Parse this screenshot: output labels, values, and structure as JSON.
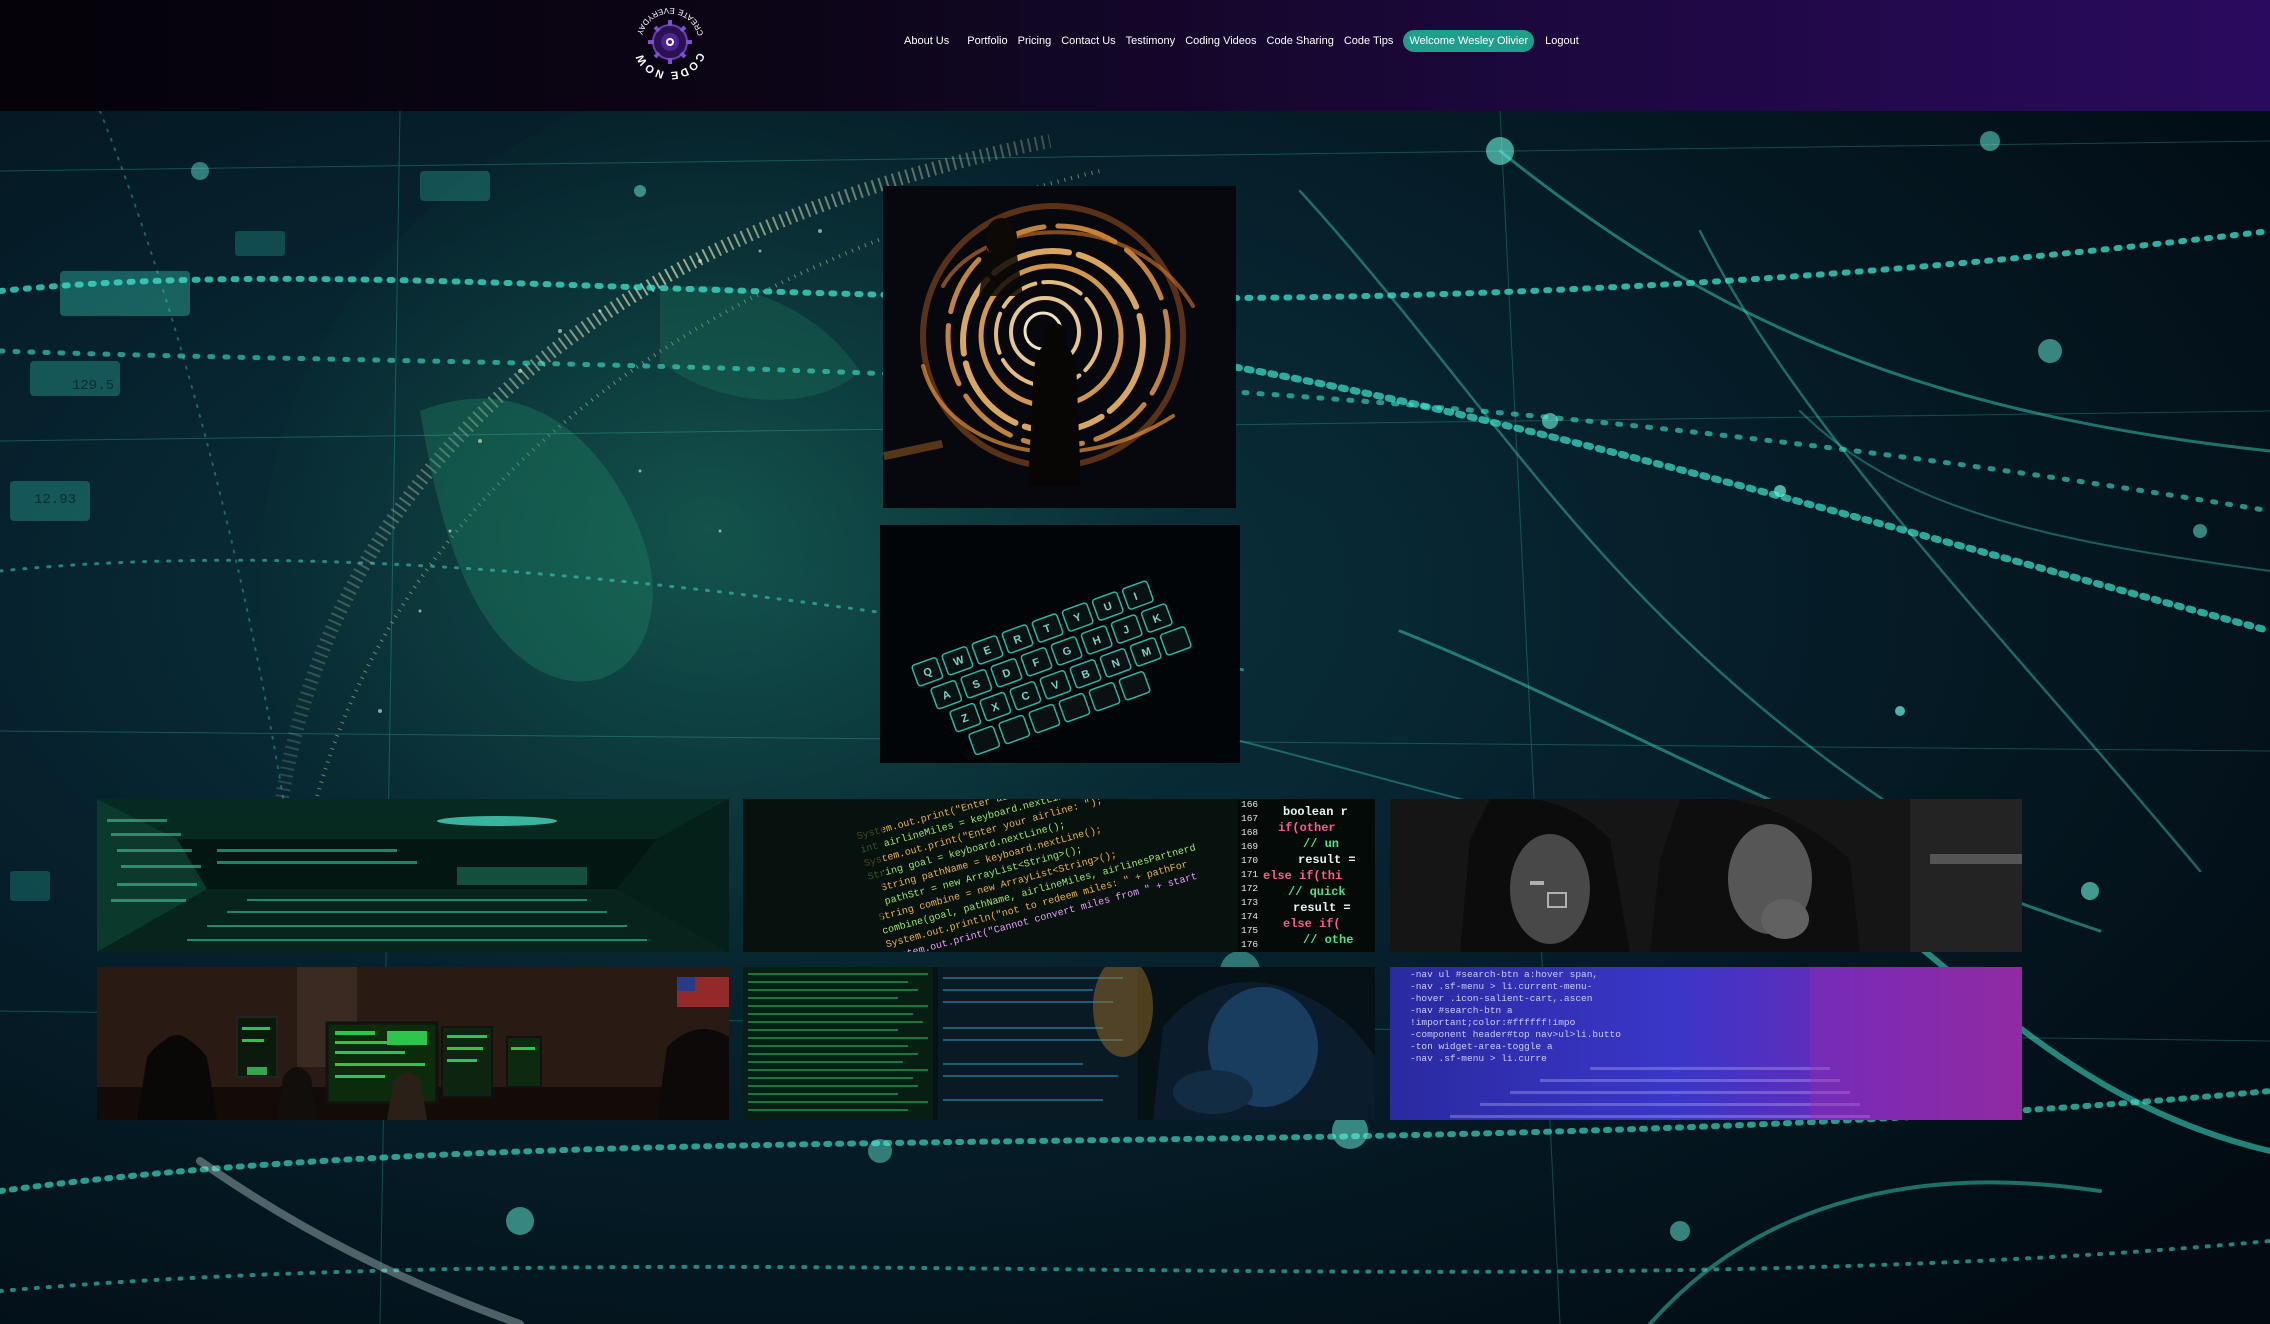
{
  "logo": {
    "top_text": "CODE NOW",
    "bottom_text": "CREATE EVERYDAY",
    "icon": "gear-brain-logo"
  },
  "nav": {
    "items": [
      {
        "label": "About Us"
      },
      {
        "label": "Portfolio"
      },
      {
        "label": "Pricing"
      },
      {
        "label": "Contact Us"
      },
      {
        "label": "Testimony"
      },
      {
        "label": "Coding Videos"
      },
      {
        "label": "Code Sharing"
      },
      {
        "label": "Code Tips"
      },
      {
        "label": "Welcome Wesley Olivier"
      },
      {
        "label": "Logout"
      }
    ]
  },
  "code_snippets": {
    "line_numbers": [
      "166",
      "167",
      "168",
      "169",
      "170",
      "171",
      "172",
      "173",
      "174",
      "175",
      "176"
    ],
    "right_column": [
      "boolean r",
      "if(other",
      "// un",
      "result =",
      "else if(thi",
      "// quick",
      "result =",
      "else if(",
      "// othe"
    ],
    "center": [
      "System.out.print(\"Enter airline miles are on: \");",
      "int airlineMiles = keyboard.nextLine();",
      "System.out.print(\"Enter your airline: \");",
      "String goal = keyboard.nextLine();",
      "String pathName = keyboard.nextLine();",
      "pathStr = new ArrayList<String>();",
      "String combine = new ArrayList<String>();",
      "combine(goal, pathName, airlineMiles, airlinesPartnerd",
      "System.out.println(\"not to redeem miles: \" + pathFor",
      "System.out.print(\"Cannot convert miles from \" + start"
    ],
    "purple": [
      "-nav ul #search-btn a:hover span,",
      "-nav .sf-menu > li.current-menu-",
      "-hover .icon-salient-cart,.ascen",
      "-nav #search-btn a",
      "!important;color:#ffffff!impo",
      "-component header#top nav>ul>li.butto",
      "-ton widget-area-toggle a",
      "-nav .sf-menu > li.curre"
    ],
    "world_labels": [
      "129.5",
      "12.93"
    ]
  },
  "colors": {
    "accent": "#1f9e8c",
    "header_start": "#050209",
    "header_end": "#2a0a5e",
    "network_cyan": "#38e0c8",
    "background": "#03121c"
  }
}
